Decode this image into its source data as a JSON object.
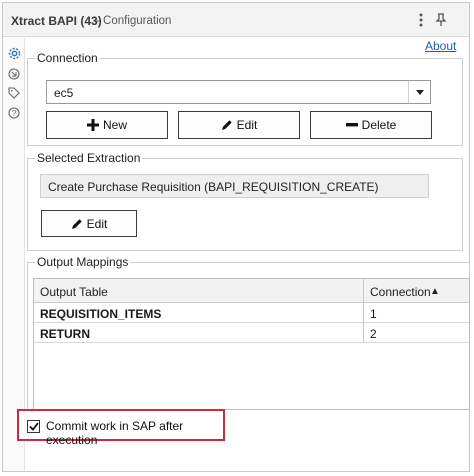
{
  "window": {
    "title": "Xtract BAPI (43)",
    "subtitle": "- Configuration",
    "about_link": "About"
  },
  "connection": {
    "group_label": "Connection",
    "selected_value": "ec5",
    "new_label": "New",
    "edit_label": "Edit",
    "delete_label": "Delete"
  },
  "selected_extraction": {
    "group_label": "Selected Extraction",
    "value": "Create Purchase Requisition (BAPI_REQUISITION_CREATE)",
    "edit_label": "Edit"
  },
  "output_mappings": {
    "group_label": "Output Mappings",
    "columns": [
      "Output Table",
      "Connection"
    ],
    "sort_indicator": "▲",
    "rows": [
      {
        "table": "REQUISITION_ITEMS",
        "connection": "1"
      },
      {
        "table": "RETURN",
        "connection": "2"
      }
    ]
  },
  "commit": {
    "label": "Commit work in SAP after execution",
    "checked": true
  },
  "colors": {
    "highlight_border": "#d2283c",
    "link": "#1e5fb3",
    "rail_active": "#2f6fb3"
  }
}
